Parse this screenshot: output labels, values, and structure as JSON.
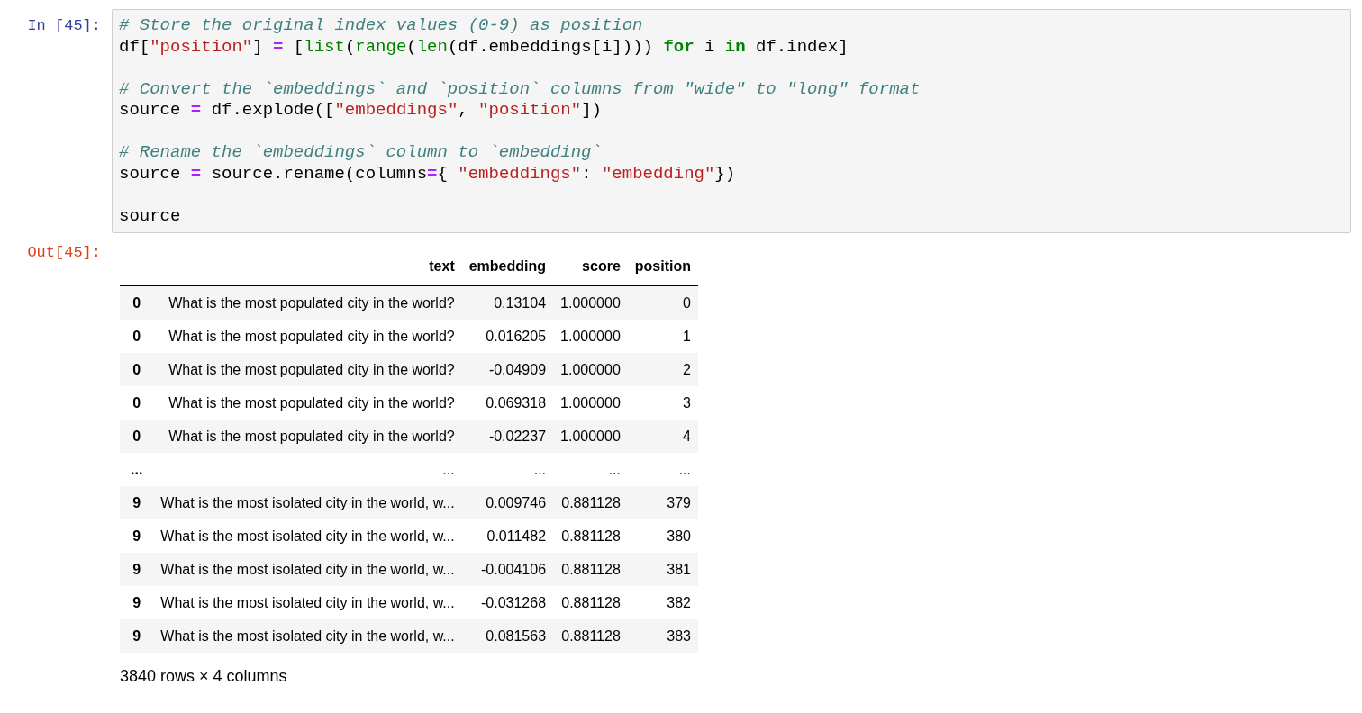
{
  "input_cell": {
    "prompt": "In [45]:",
    "code_blocks": [
      [
        [
          {
            "kind": "comment",
            "t": "# Store the original index values (0-9) as position"
          }
        ],
        [
          {
            "kind": "plain",
            "t": "df["
          },
          {
            "kind": "str",
            "t": "\"position\""
          },
          {
            "kind": "plain",
            "t": "] "
          },
          {
            "kind": "op",
            "t": "="
          },
          {
            "kind": "plain",
            "t": " ["
          },
          {
            "kind": "builtin",
            "t": "list"
          },
          {
            "kind": "plain",
            "t": "("
          },
          {
            "kind": "builtin",
            "t": "range"
          },
          {
            "kind": "plain",
            "t": "("
          },
          {
            "kind": "builtin",
            "t": "len"
          },
          {
            "kind": "plain",
            "t": "(df.embeddings[i]))) "
          },
          {
            "kind": "kw",
            "t": "for"
          },
          {
            "kind": "plain",
            "t": " i "
          },
          {
            "kind": "kw",
            "t": "in"
          },
          {
            "kind": "plain",
            "t": " df.index]"
          }
        ]
      ],
      [
        [
          {
            "kind": "comment",
            "t": "# Convert the `embeddings` and `position` columns from \"wide\" to \"long\" format"
          }
        ],
        [
          {
            "kind": "plain",
            "t": "source "
          },
          {
            "kind": "op",
            "t": "="
          },
          {
            "kind": "plain",
            "t": " df.explode(["
          },
          {
            "kind": "str",
            "t": "\"embeddings\""
          },
          {
            "kind": "plain",
            "t": ", "
          },
          {
            "kind": "str",
            "t": "\"position\""
          },
          {
            "kind": "plain",
            "t": "])"
          }
        ]
      ],
      [
        [
          {
            "kind": "comment",
            "t": "# Rename the `embeddings` column to `embedding`"
          }
        ],
        [
          {
            "kind": "plain",
            "t": "source "
          },
          {
            "kind": "op",
            "t": "="
          },
          {
            "kind": "plain",
            "t": " source.rename(columns"
          },
          {
            "kind": "op",
            "t": "="
          },
          {
            "kind": "plain",
            "t": "{ "
          },
          {
            "kind": "str",
            "t": "\"embeddings\""
          },
          {
            "kind": "plain",
            "t": ": "
          },
          {
            "kind": "str",
            "t": "\"embedding\""
          },
          {
            "kind": "plain",
            "t": "})"
          }
        ]
      ],
      [
        [
          {
            "kind": "plain",
            "t": "source"
          }
        ]
      ]
    ]
  },
  "output_cell": {
    "prompt": "Out[45]:",
    "table": {
      "columns": [
        "text",
        "embedding",
        "score",
        "position"
      ],
      "rows": [
        {
          "kind": "data",
          "index": "0",
          "cells": [
            "What is the most populated city in the world?",
            "0.13104",
            "1.000000",
            "0"
          ]
        },
        {
          "kind": "data",
          "index": "0",
          "cells": [
            "What is the most populated city in the world?",
            "0.016205",
            "1.000000",
            "1"
          ]
        },
        {
          "kind": "data",
          "index": "0",
          "cells": [
            "What is the most populated city in the world?",
            "-0.04909",
            "1.000000",
            "2"
          ]
        },
        {
          "kind": "data",
          "index": "0",
          "cells": [
            "What is the most populated city in the world?",
            "0.069318",
            "1.000000",
            "3"
          ]
        },
        {
          "kind": "data",
          "index": "0",
          "cells": [
            "What is the most populated city in the world?",
            "-0.02237",
            "1.000000",
            "4"
          ]
        },
        {
          "kind": "ellipsis",
          "index": "...",
          "cells": [
            "...",
            "...",
            "...",
            "..."
          ]
        },
        {
          "kind": "data",
          "index": "9",
          "cells": [
            "What is the most isolated city in the world, w...",
            "0.009746",
            "0.881128",
            "379"
          ]
        },
        {
          "kind": "data",
          "index": "9",
          "cells": [
            "What is the most isolated city in the world, w...",
            "0.011482",
            "0.881128",
            "380"
          ]
        },
        {
          "kind": "data",
          "index": "9",
          "cells": [
            "What is the most isolated city in the world, w...",
            "-0.004106",
            "0.881128",
            "381"
          ]
        },
        {
          "kind": "data",
          "index": "9",
          "cells": [
            "What is the most isolated city in the world, w...",
            "-0.031268",
            "0.881128",
            "382"
          ]
        },
        {
          "kind": "data",
          "index": "9",
          "cells": [
            "What is the most isolated city in the world, w...",
            "0.081563",
            "0.881128",
            "383"
          ]
        }
      ]
    },
    "summary": "3840 rows × 4 columns"
  }
}
